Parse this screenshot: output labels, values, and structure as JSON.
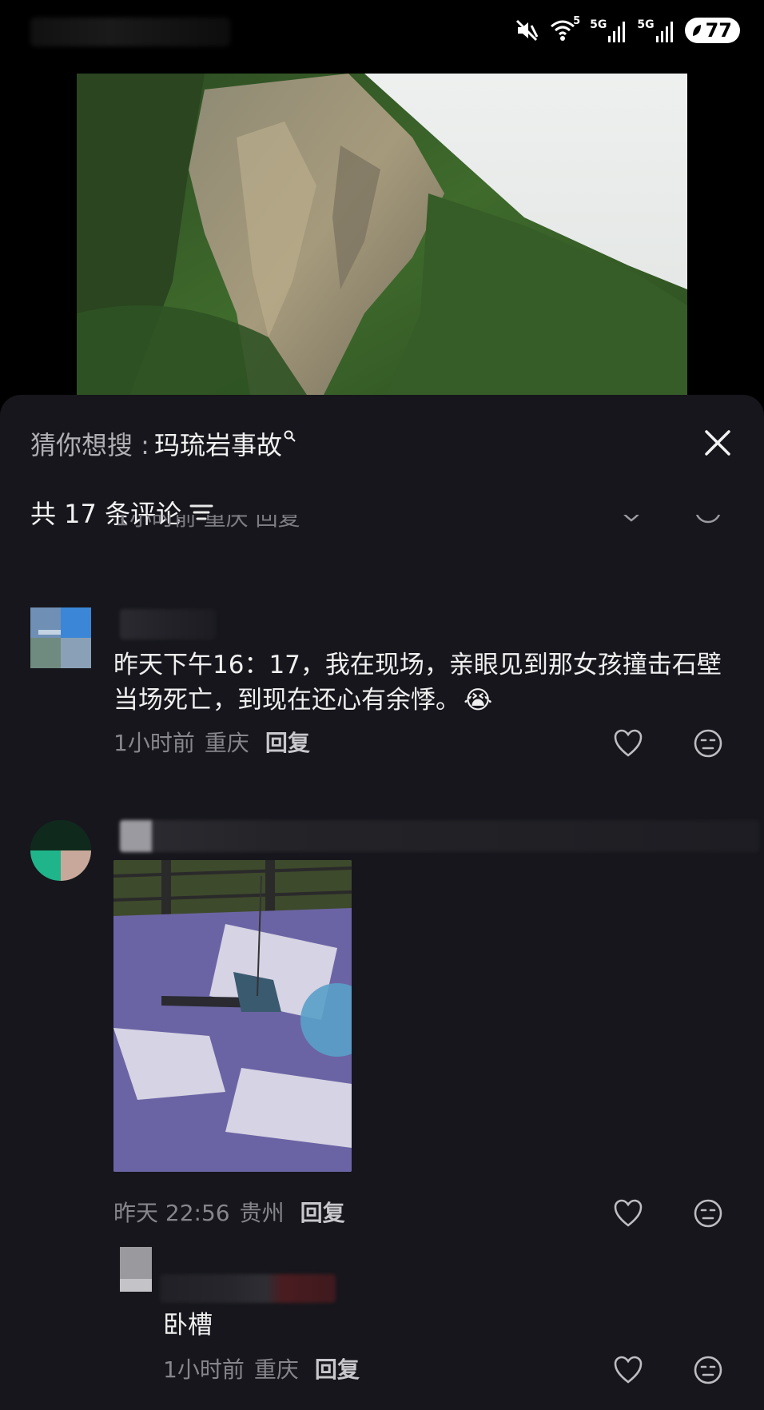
{
  "status_bar": {
    "battery_level": "77",
    "signal_1": "5G",
    "signal_2": "5G",
    "wifi_badge": "5"
  },
  "sheet": {
    "suggest_prefix": "猜你想搜 : ",
    "suggest_query": "玛琉岩事故",
    "comment_count_label": "共 17 条评论",
    "clipped_meta": "1小时前 重庆  回复"
  },
  "comments": [
    {
      "text": "昨天下午16：17，我在现场，亲眼见到那女孩撞击石壁当场死亡，到现在还心有余悸。",
      "emoji": "😭",
      "time": "1小时前",
      "location": "重庆",
      "reply_label": "回复"
    },
    {
      "text": "",
      "time": "昨天 22:56",
      "location": "贵州",
      "reply_label": "回复"
    },
    {
      "text": "卧槽",
      "time": "1小时前",
      "location": "重庆",
      "reply_label": "回复"
    }
  ],
  "colors": {
    "sheet_bg": "#16161c",
    "text_primary": "#efefef",
    "text_secondary": "#86868c"
  }
}
